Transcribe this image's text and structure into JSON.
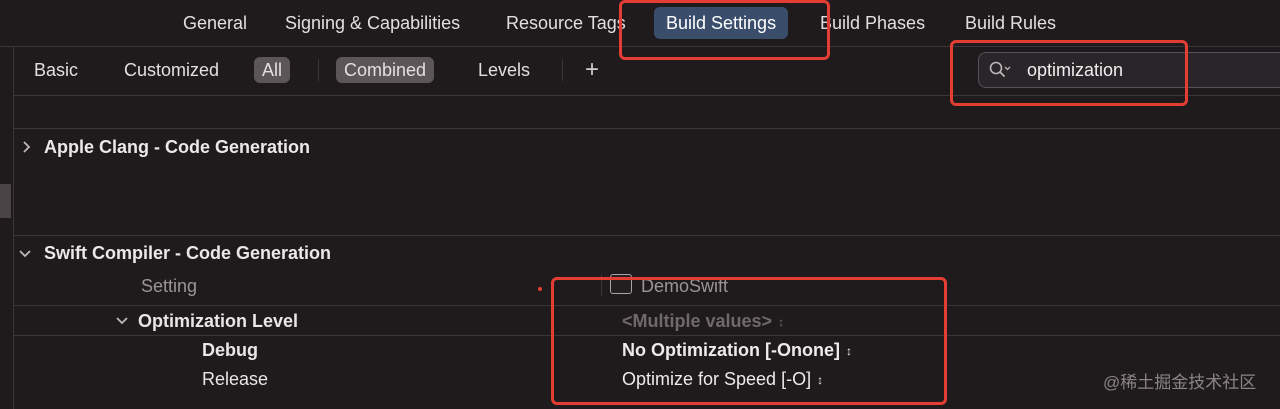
{
  "tabs": {
    "items": [
      {
        "label": "General"
      },
      {
        "label": "Signing & Capabilities"
      },
      {
        "label": "Resource Tags"
      },
      {
        "label": "Build Settings",
        "active": true
      },
      {
        "label": "Build Phases"
      },
      {
        "label": "Build Rules"
      }
    ]
  },
  "filters": {
    "basic": "Basic",
    "customized": "Customized",
    "all": "All",
    "combined": "Combined",
    "levels": "Levels",
    "add": "+"
  },
  "search": {
    "value": "optimization",
    "icon": "search-icon"
  },
  "sections": [
    {
      "title": "Apple Clang - Code Generation",
      "expanded": false
    },
    {
      "title": "Swift Compiler - Code Generation",
      "expanded": true
    }
  ],
  "table": {
    "header_label": "Setting",
    "target_name": "DemoSwift",
    "rows": [
      {
        "label": "Optimization Level",
        "value": "<Multiple values>"
      },
      {
        "label": "Debug",
        "value": "No Optimization [-Onone]"
      },
      {
        "label": "Release",
        "value": "Optimize for Speed [-O]"
      }
    ]
  },
  "watermark": "@稀土掘金技术社区",
  "colors": {
    "background": "#1f1b1d",
    "active_tab": "#3a4e6c",
    "annotation": "#e43d33",
    "pill": "#5c5659"
  }
}
